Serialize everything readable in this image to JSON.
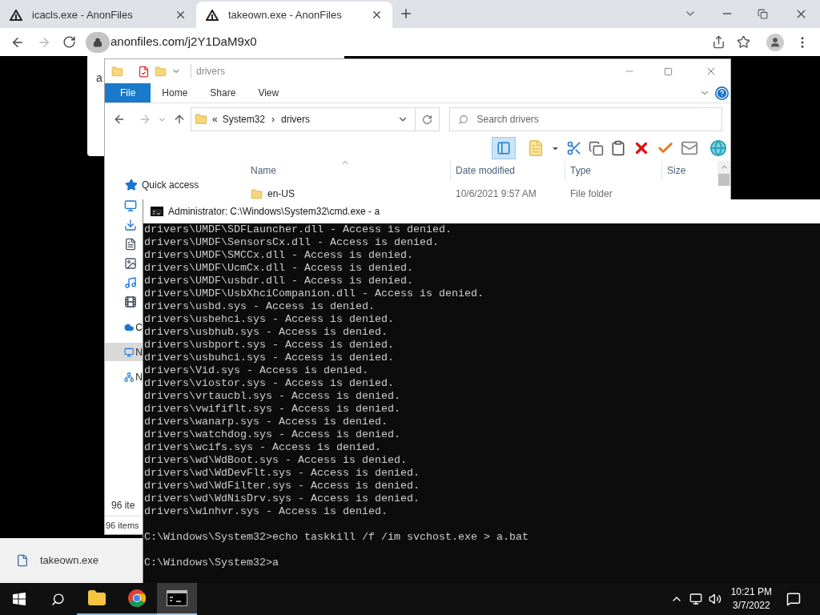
{
  "browser": {
    "tabs": [
      {
        "title": "icacls.exe - AnonFiles",
        "selected": false
      },
      {
        "title": "takeown.exe - AnonFiles",
        "selected": true
      }
    ],
    "address": "anonfiles.com/j2Y1DaM9x0"
  },
  "page_dialog": {
    "text": "a"
  },
  "explorer": {
    "title": "drivers",
    "ribbon_tabs": [
      {
        "label": "File",
        "selected": true
      },
      {
        "label": "Home",
        "selected": false
      },
      {
        "label": "Share",
        "selected": false
      },
      {
        "label": "View",
        "selected": false
      }
    ],
    "breadcrumb": [
      "«",
      "System32",
      "›",
      "drivers"
    ],
    "search": {
      "placeholder": "Search drivers"
    },
    "nav": [
      {
        "kind": "quick",
        "label": "Quick access",
        "selected": false
      },
      {
        "kind": "desktop",
        "selected": false
      },
      {
        "kind": "downloads",
        "selected": false
      },
      {
        "kind": "documents",
        "selected": false
      },
      {
        "kind": "pictures",
        "selected": false
      },
      {
        "kind": "music",
        "selected": false
      },
      {
        "kind": "videos",
        "selected": false
      },
      {
        "kind": "cloud",
        "label": "C",
        "selected": false
      },
      {
        "kind": "pc",
        "label": "N",
        "selected": true
      },
      {
        "kind": "network",
        "label": "N",
        "selected": false
      }
    ],
    "columns": [
      "Name",
      "Date modified",
      "Type",
      "Size"
    ],
    "rows": [
      {
        "name": "en-US",
        "date": "10/6/2021 9:57 AM",
        "type": "File folder"
      }
    ],
    "item_count_overlay": "96 ite",
    "status": "96 items"
  },
  "cmd": {
    "title": "Administrator: C:\\Windows\\System32\\cmd.exe - a",
    "lines": [
      "drivers\\UMDF\\SDFLauncher.dll - Access is denied.",
      "drivers\\UMDF\\SensorsCx.dll - Access is denied.",
      "drivers\\UMDF\\SMCCx.dll - Access is denied.",
      "drivers\\UMDF\\UcmCx.dll - Access is denied.",
      "drivers\\UMDF\\usbdr.dll - Access is denied.",
      "drivers\\UMDF\\UsbXhciCompanion.dll - Access is denied.",
      "drivers\\usbd.sys - Access is denied.",
      "drivers\\usbehci.sys - Access is denied.",
      "drivers\\usbhub.sys - Access is denied.",
      "drivers\\usbport.sys - Access is denied.",
      "drivers\\usbuhci.sys - Access is denied.",
      "drivers\\Vid.sys - Access is denied.",
      "drivers\\viostor.sys - Access is denied.",
      "drivers\\vrtaucbl.sys - Access is denied.",
      "drivers\\vwififlt.sys - Access is denied.",
      "drivers\\wanarp.sys - Access is denied.",
      "drivers\\watchdog.sys - Access is denied.",
      "drivers\\wcifs.sys - Access is denied.",
      "drivers\\wd\\WdBoot.sys - Access is denied.",
      "drivers\\wd\\WdDevFlt.sys - Access is denied.",
      "drivers\\wd\\WdFilter.sys - Access is denied.",
      "drivers\\wd\\WdNisDrv.sys - Access is denied.",
      "drivers\\winhvr.sys - Access is denied."
    ],
    "prompts": [
      "C:\\Windows\\System32>echo taskkill /f /im svchost.exe > a.bat",
      "C:\\Windows\\System32>a"
    ]
  },
  "download": {
    "file": "takeown.exe"
  },
  "taskbar": {
    "apps": [
      {
        "kind": "explorer",
        "selected": false
      },
      {
        "kind": "chrome",
        "selected": false
      },
      {
        "kind": "cmd",
        "selected": true
      }
    ],
    "time": "10:21 PM",
    "date": "3/7/2022"
  }
}
